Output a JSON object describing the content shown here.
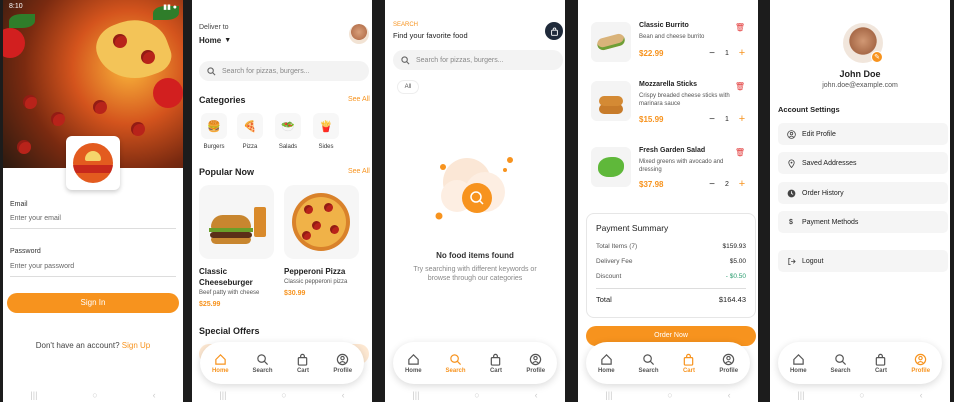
{
  "login": {
    "status_time": "8:10",
    "email_label": "Email",
    "email_placeholder": "Enter your email",
    "password_label": "Password",
    "password_placeholder": "Enter your password",
    "signin_label": "Sign In",
    "no_account_text": "Don't have an account?",
    "signup_link": "Sign Up"
  },
  "home": {
    "deliver_to": "Deliver to",
    "location": "Home",
    "search_placeholder": "Search for pizzas, burgers...",
    "categories_title": "Categories",
    "popular_title": "Popular Now",
    "see_all": "See All",
    "special_offers_title": "Special Offers",
    "categories": [
      {
        "label": "Burgers",
        "icon": "burger-icon"
      },
      {
        "label": "Pizza",
        "icon": "pizza-icon"
      },
      {
        "label": "Salads",
        "icon": "salad-icon"
      },
      {
        "label": "Sides",
        "icon": "fries-icon"
      }
    ],
    "popular": [
      {
        "name": "Classic Cheeseburger",
        "desc": "Beef patty with cheese",
        "price": "$25.99"
      },
      {
        "name": "Pepperoni Pizza",
        "desc": "Classic pepperoni pizza",
        "price": "$30.99"
      }
    ]
  },
  "search": {
    "eyebrow": "SEARCH",
    "title": "Find your favorite food",
    "placeholder": "Search for pizzas, burgers...",
    "chip": "All",
    "empty_title": "No food items found",
    "empty_sub": "Try searching with different keywords or browse through our categories"
  },
  "cart": {
    "items": [
      {
        "name": "Classic Burrito",
        "desc": "Bean and cheese burrito",
        "price": "$22.99",
        "qty": "1"
      },
      {
        "name": "Mozzarella Sticks",
        "desc": "Crispy breaded cheese sticks with marinara sauce",
        "price": "$15.99",
        "qty": "1"
      },
      {
        "name": "Fresh Garden Salad",
        "desc": "Mixed greens with avocado and dressing",
        "price": "$37.98",
        "qty": "2"
      }
    ],
    "summary_title": "Payment Summary",
    "total_items_label": "Total Items (7)",
    "total_items_value": "$159.93",
    "delivery_label": "Delivery Fee",
    "delivery_value": "$5.00",
    "discount_label": "Discount",
    "discount_value": "- $0.50",
    "total_label": "Total",
    "total_value": "$164.43",
    "order_label": "Order Now"
  },
  "profile": {
    "name": "John Doe",
    "email": "john.doe@example.com",
    "settings_title": "Account Settings",
    "menu": [
      {
        "label": "Edit Profile",
        "icon": "user-icon"
      },
      {
        "label": "Saved Addresses",
        "icon": "location-pin-icon"
      },
      {
        "label": "Order History",
        "icon": "clock-icon"
      },
      {
        "label": "Payment Methods",
        "icon": "dollar-icon"
      }
    ],
    "logout_label": "Logout"
  },
  "tabs": {
    "home": "Home",
    "search": "Search",
    "cart": "Cart",
    "profile": "Profile"
  },
  "colors": {
    "accent": "#f7931e",
    "danger": "#e23a3a",
    "discount": "#2a9d6f"
  }
}
